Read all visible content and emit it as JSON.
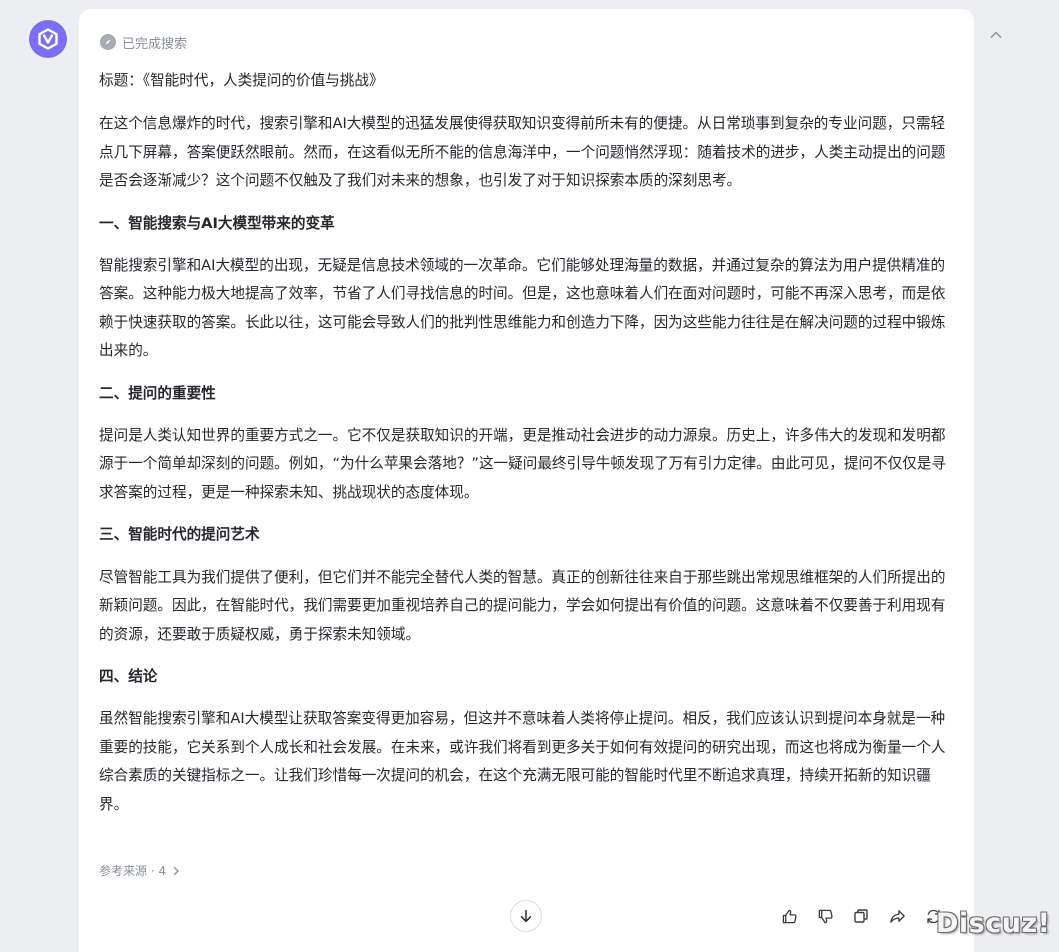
{
  "status": {
    "search_done": "已完成搜索"
  },
  "article": {
    "title": "标题：《智能时代，人类提问的价值与挑战》",
    "intro": "在这个信息爆炸的时代，搜索引擎和AI大模型的迅猛发展使得获取知识变得前所未有的便捷。从日常琐事到复杂的专业问题，只需轻点几下屏幕，答案便跃然眼前。然而，在这看似无所不能的信息海洋中，一个问题悄然浮现：随着技术的进步，人类主动提出的问题是否会逐渐减少？这个问题不仅触及了我们对未来的想象，也引发了对于知识探索本质的深刻思考。",
    "sections": [
      {
        "heading": "一、智能搜索与AI大模型带来的变革",
        "body": "智能搜索引擎和AI大模型的出现，无疑是信息技术领域的一次革命。它们能够处理海量的数据，并通过复杂的算法为用户提供精准的答案。这种能力极大地提高了效率，节省了人们寻找信息的时间。但是，这也意味着人们在面对问题时，可能不再深入思考，而是依赖于快速获取的答案。长此以往，这可能会导致人们的批判性思维能力和创造力下降，因为这些能力往往是在解决问题的过程中锻炼出来的。"
      },
      {
        "heading": "二、提问的重要性",
        "body": "提问是人类认知世界的重要方式之一。它不仅是获取知识的开端，更是推动社会进步的动力源泉。历史上，许多伟大的发现和发明都源于一个简单却深刻的问题。例如，“为什么苹果会落地？”这一疑问最终引导牛顿发现了万有引力定律。由此可见，提问不仅仅是寻求答案的过程，更是一种探索未知、挑战现状的态度体现。"
      },
      {
        "heading": "三、智能时代的提问艺术",
        "body": "尽管智能工具为我们提供了便利，但它们并不能完全替代人类的智慧。真正的创新往往来自于那些跳出常规思维框架的人们所提出的新颖问题。因此，在智能时代，我们需要更加重视培养自己的提问能力，学会如何提出有价值的问题。这意味着不仅要善于利用现有的资源，还要敢于质疑权威，勇于探索未知领域。"
      },
      {
        "heading": "四、结论",
        "body": "虽然智能搜索引擎和AI大模型让获取答案变得更加容易，但这并不意味着人类将停止提问。相反，我们应该认识到提问本身就是一种重要的技能，它关系到个人成长和社会发展。在未来，或许我们将看到更多关于如何有效提问的研究出现，而这也将成为衡量一个人综合素质的关键指标之一。让我们珍惜每一次提问的机会，在这个充满无限可能的智能时代里不断追求真理，持续开拓新的知识疆界。"
      }
    ]
  },
  "sources": {
    "label": "参考来源 · 4"
  },
  "watermark": "Discuz!",
  "colors": {
    "accent": "#7b6ff0",
    "background": "#eceef1",
    "card": "#ffffff",
    "muted_text": "#8a8f99",
    "body_text": "#26282d"
  },
  "icons": {
    "avatar": "assistant-logo-icon",
    "collapse": "chevron-up-icon",
    "status": "compass-icon",
    "sources": "chevron-right-icon",
    "scroll": "arrow-down-icon",
    "actions": [
      "thumbs-up-icon",
      "thumbs-down-icon",
      "copy-icon",
      "share-icon",
      "refresh-icon"
    ]
  }
}
